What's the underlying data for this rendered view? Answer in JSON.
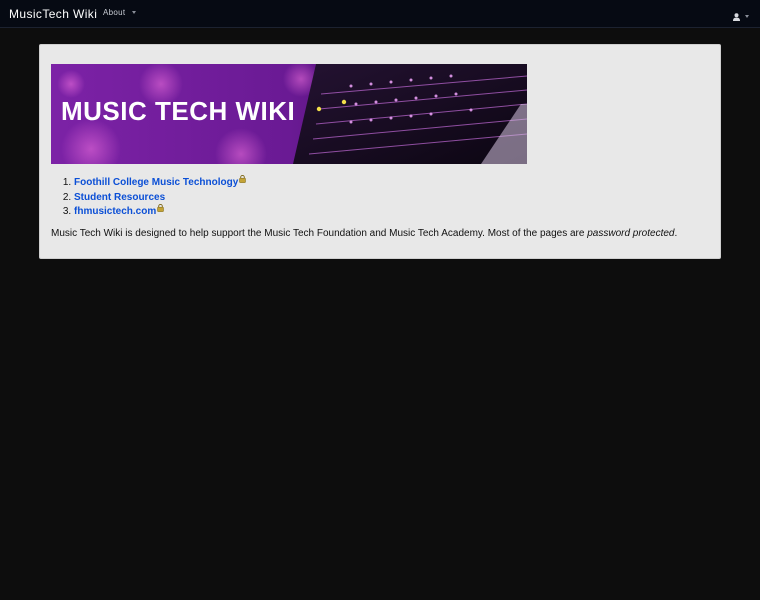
{
  "navbar": {
    "brand": "MusicTech Wiki",
    "about_label": "About",
    "user_icon": "user-icon"
  },
  "banner": {
    "title": "MUSIC TECH WIKI",
    "colors": {
      "left": "#7d1fa8",
      "right": "#3a0a55",
      "text": "#ffffff"
    }
  },
  "links": [
    {
      "label": "Foothill College Music Technology",
      "locked": true
    },
    {
      "label": "Student Resources",
      "locked": false
    },
    {
      "label": "fhmusictech.com",
      "locked": true
    }
  ],
  "description": {
    "text": "Music Tech Wiki is designed to help support the Music Tech Foundation and Music Tech Academy. Most of the pages are ",
    "emphasis": "password protected",
    "end": "."
  },
  "colors": {
    "page_bg": "#0d0d0d",
    "navbar_bg": "#060a13",
    "panel_bg": "#e8e8e8",
    "link": "#0b4fd6"
  }
}
